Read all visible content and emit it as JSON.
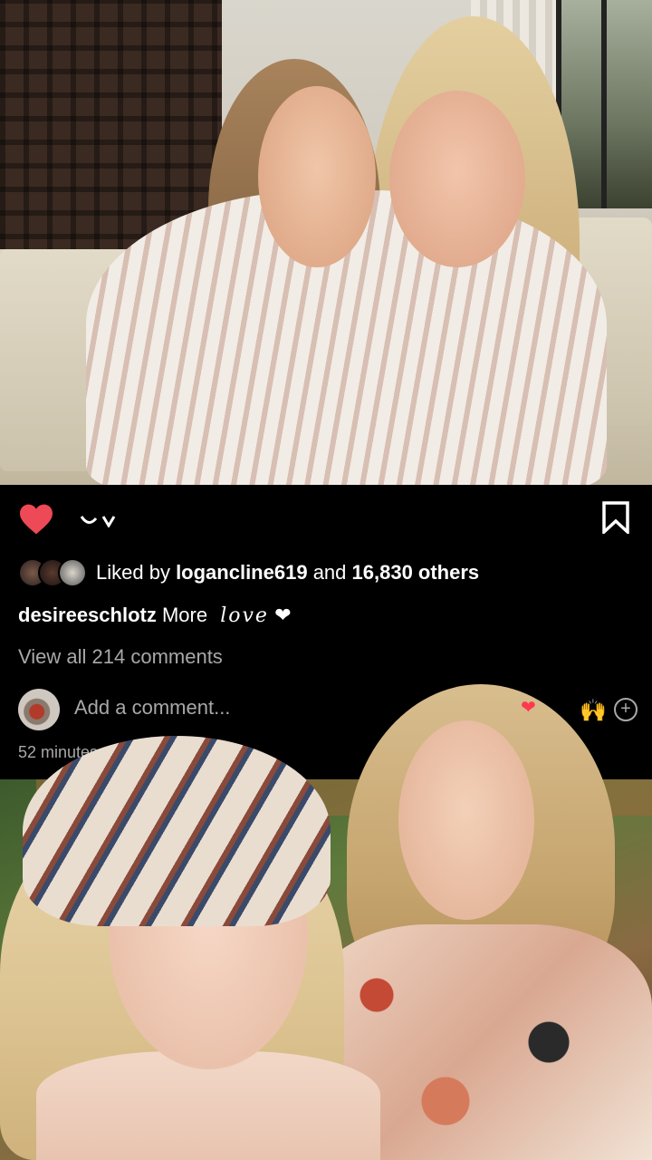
{
  "post": {
    "liked_by_prefix": "Liked by ",
    "liked_by_user": "logancline619",
    "liked_by_and": " and ",
    "likes_count": "16,830 others",
    "caption_user": "desireeschlotz",
    "caption_more": "More",
    "caption_text": "love",
    "caption_emoji": "❤",
    "view_comments": "View all 214 comments",
    "comment_placeholder": "Add a comment...",
    "timestamp": "52 minutes a",
    "liked": true
  },
  "emoji": {
    "hands": "🙌",
    "heart": "❤"
  },
  "icons": {
    "like": "heart-icon",
    "comment": "comment-icon",
    "bookmark": "bookmark-icon",
    "add_emoji": "plus-circle-icon"
  },
  "colors": {
    "heart": "#ed4956",
    "secondary_text": "#a8a8a8",
    "background": "#000000"
  }
}
